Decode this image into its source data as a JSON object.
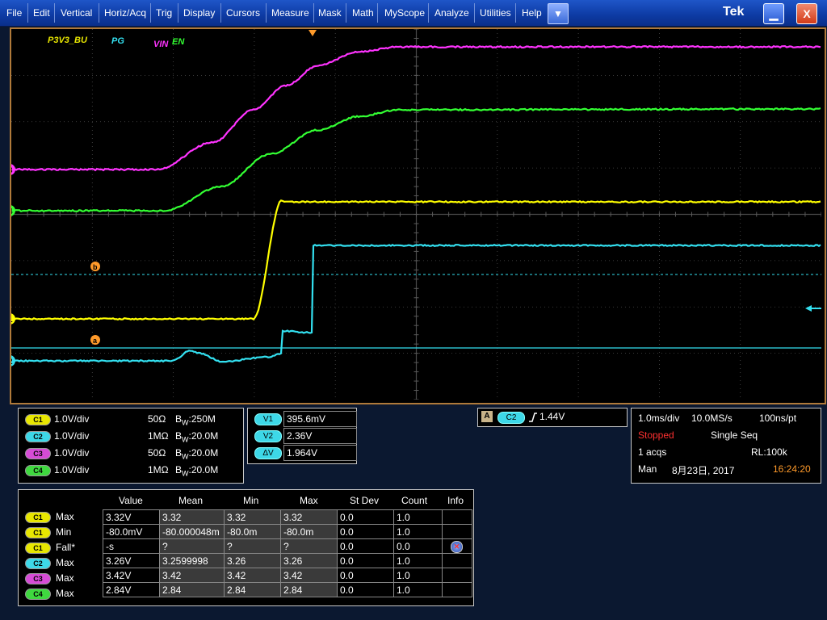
{
  "menu": {
    "items": [
      "File",
      "Edit",
      "Vertical",
      "Horiz/Acq",
      "Trig",
      "Display",
      "Cursors",
      "Measure",
      "Mask",
      "Math",
      "MyScope",
      "Analyze",
      "Utilities",
      "Help"
    ],
    "dropdown_icon": "triangle-down-icon",
    "brand": "Tek",
    "minimize_icon": "minimize-icon",
    "close_label": "X"
  },
  "scope": {
    "labels": {
      "p3v3": "P3V3_BU",
      "pg": "PG",
      "vin": "VIN",
      "en": "EN"
    },
    "channel_markers": {
      "ch3": "3",
      "ch4": "4",
      "ch1": "1",
      "ch2": "2"
    },
    "cursor_markers": {
      "b": "b",
      "a": "a"
    },
    "colors": {
      "ch1": "#ffff00",
      "ch2": "#33e0f0",
      "ch3": "#ff33ff",
      "ch4": "#33ff33",
      "cursor": "#ff9a2a",
      "grid": "#6a6a6a"
    }
  },
  "channels": [
    {
      "badge": "C1",
      "scale": "1.0V/div",
      "impedance": "50Ω",
      "bw_prefix": "B",
      "bw_sub": "W",
      "bw": ":250M"
    },
    {
      "badge": "C2",
      "scale": "1.0V/div",
      "impedance": "1MΩ",
      "bw_prefix": "B",
      "bw_sub": "W",
      "bw": ":20.0M"
    },
    {
      "badge": "C3",
      "scale": "1.0V/div",
      "impedance": "50Ω",
      "bw_prefix": "B",
      "bw_sub": "W",
      "bw": ":20.0M"
    },
    {
      "badge": "C4",
      "scale": "1.0V/div",
      "impedance": "1MΩ",
      "bw_prefix": "B",
      "bw_sub": "W",
      "bw": ":20.0M"
    }
  ],
  "cursors": [
    {
      "badge": "V1",
      "value": "395.6mV"
    },
    {
      "badge": "V2",
      "value": "2.36V"
    },
    {
      "badge": "ΔV",
      "value": "1.964V"
    }
  ],
  "trigger": {
    "mode_badge": "A",
    "source": "C2",
    "slope_icon": "rising-edge-icon",
    "level": "1.44V"
  },
  "acquisition": {
    "timebase": "1.0ms/div",
    "sample_rate": "10.0MS/s",
    "resolution": "100ns/pt",
    "state": "Stopped",
    "mode": "Single Seq",
    "acqs": "1 acqs",
    "record_length": "RL:100k",
    "user": "Man",
    "date": "8月23日, 2017",
    "time": "16:24:20"
  },
  "measurements": {
    "headers": [
      "Value",
      "Mean",
      "Min",
      "Max",
      "St Dev",
      "Count",
      "Info"
    ],
    "rows": [
      {
        "badge": "C1",
        "name": "Max",
        "value": "3.32V",
        "mean": "3.32",
        "min": "3.32",
        "max": "3.32",
        "stdev": "0.0",
        "count": "1.0",
        "info": ""
      },
      {
        "badge": "C1",
        "name": "Min",
        "value": "-80.0mV",
        "mean": "-80.000048m",
        "min": "-80.0m",
        "max": "-80.0m",
        "stdev": "0.0",
        "count": "1.0",
        "info": ""
      },
      {
        "badge": "C1",
        "name": "Fall*",
        "value": "-s",
        "mean": "?",
        "min": "?",
        "max": "?",
        "stdev": "0.0",
        "count": "0.0",
        "info": "info-icon"
      },
      {
        "badge": "C2",
        "name": "Max",
        "value": "3.26V",
        "mean": "3.2599998",
        "min": "3.26",
        "max": "3.26",
        "stdev": "0.0",
        "count": "1.0",
        "info": ""
      },
      {
        "badge": "C3",
        "name": "Max",
        "value": "3.42V",
        "mean": "3.42",
        "min": "3.42",
        "max": "3.42",
        "stdev": "0.0",
        "count": "1.0",
        "info": ""
      },
      {
        "badge": "C4",
        "name": "Max",
        "value": "2.84V",
        "mean": "2.84",
        "min": "2.84",
        "max": "2.84",
        "stdev": "0.0",
        "count": "1.0",
        "info": ""
      }
    ]
  }
}
